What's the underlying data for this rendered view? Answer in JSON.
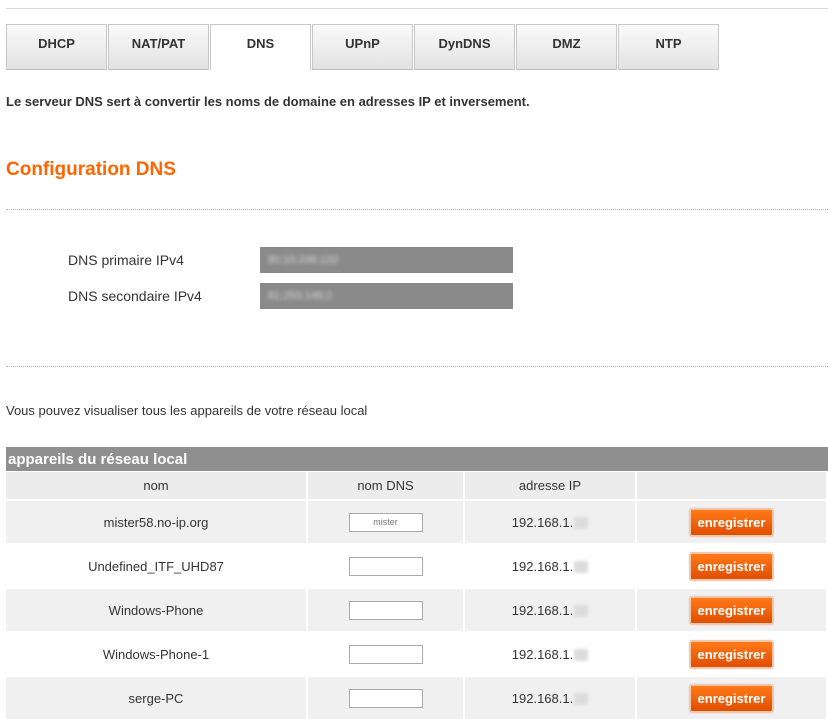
{
  "tabs": [
    {
      "label": "DHCP"
    },
    {
      "label": "NAT/PAT"
    },
    {
      "label": "DNS"
    },
    {
      "label": "UPnP"
    },
    {
      "label": "DynDNS"
    },
    {
      "label": "DMZ"
    },
    {
      "label": "NTP"
    }
  ],
  "active_tab": "DNS",
  "intro": "Le serveur DNS sert à convertir les noms de domaine en adresses IP et inversement.",
  "section_title": "Configuration DNS",
  "dns": {
    "primary_label": "DNS primaire IPv4",
    "primary_value": "80.10.246.132",
    "secondary_label": "DNS secondaire IPv4",
    "secondary_value": "81.253.149.2"
  },
  "info_text": "Vous pouvez visualiser tous les appareils de votre réseau local",
  "devices": {
    "title": "appareils du réseau local",
    "columns": [
      "nom",
      "nom DNS",
      "adresse IP",
      ""
    ],
    "button_label": "enregistrer",
    "rows": [
      {
        "name": "mister58.no-ip.org",
        "dns_value": "mister",
        "ip": "192.168.1."
      },
      {
        "name": "Undefined_ITF_UHD87",
        "dns_value": "",
        "ip": "192.168.1."
      },
      {
        "name": "Windows-Phone",
        "dns_value": "",
        "ip": "192.168.1."
      },
      {
        "name": "Windows-Phone-1",
        "dns_value": "",
        "ip": "192.168.1."
      },
      {
        "name": "serge-PC",
        "dns_value": "",
        "ip": "192.168.1."
      }
    ]
  },
  "colors": {
    "accent": "#ff6600",
    "header_bg": "#8f8f8f",
    "button": "#ff6a00"
  }
}
